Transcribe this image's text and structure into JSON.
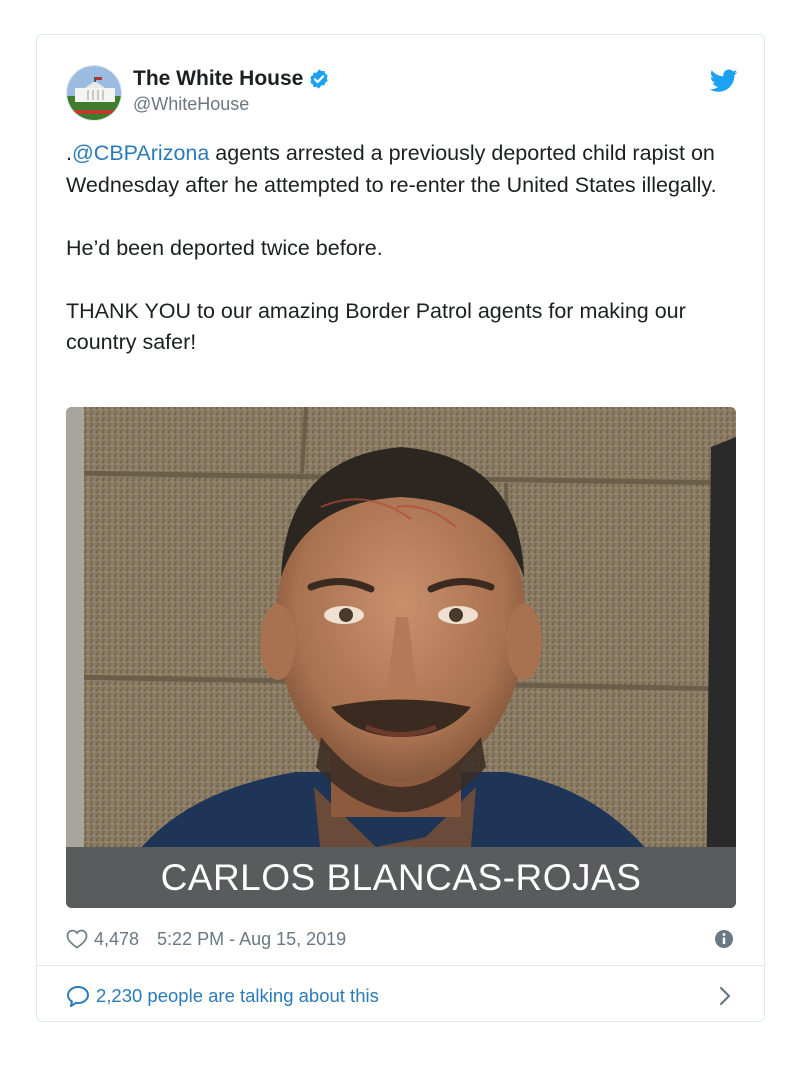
{
  "tweet": {
    "author": {
      "display_name": "The White House",
      "handle": "@WhiteHouse",
      "verified_icon": "verified-badge-icon",
      "avatar": "white-house-avatar"
    },
    "platform_icon": "twitter-bird-icon",
    "text": {
      "prefix": ".",
      "mention": "@CBPArizona",
      "body": " agents arrested a previously deported child rapist on Wednesday after he attempted to re-enter the United States illegally.\n\nHe’d been deported twice before.\n\nTHANK YOU to our amazing Border Patrol agents for making our country safer!"
    },
    "media": {
      "caption": "CARLOS BLANCAS-ROJAS"
    },
    "likes": "4,478",
    "timestamp": "5:22 PM - Aug 15, 2019",
    "talking": "2,230 people are talking about this"
  },
  "colors": {
    "link": "#2b7bb9",
    "muted": "#697882",
    "border": "#e1e8ed",
    "verified": "#1da1f2"
  }
}
